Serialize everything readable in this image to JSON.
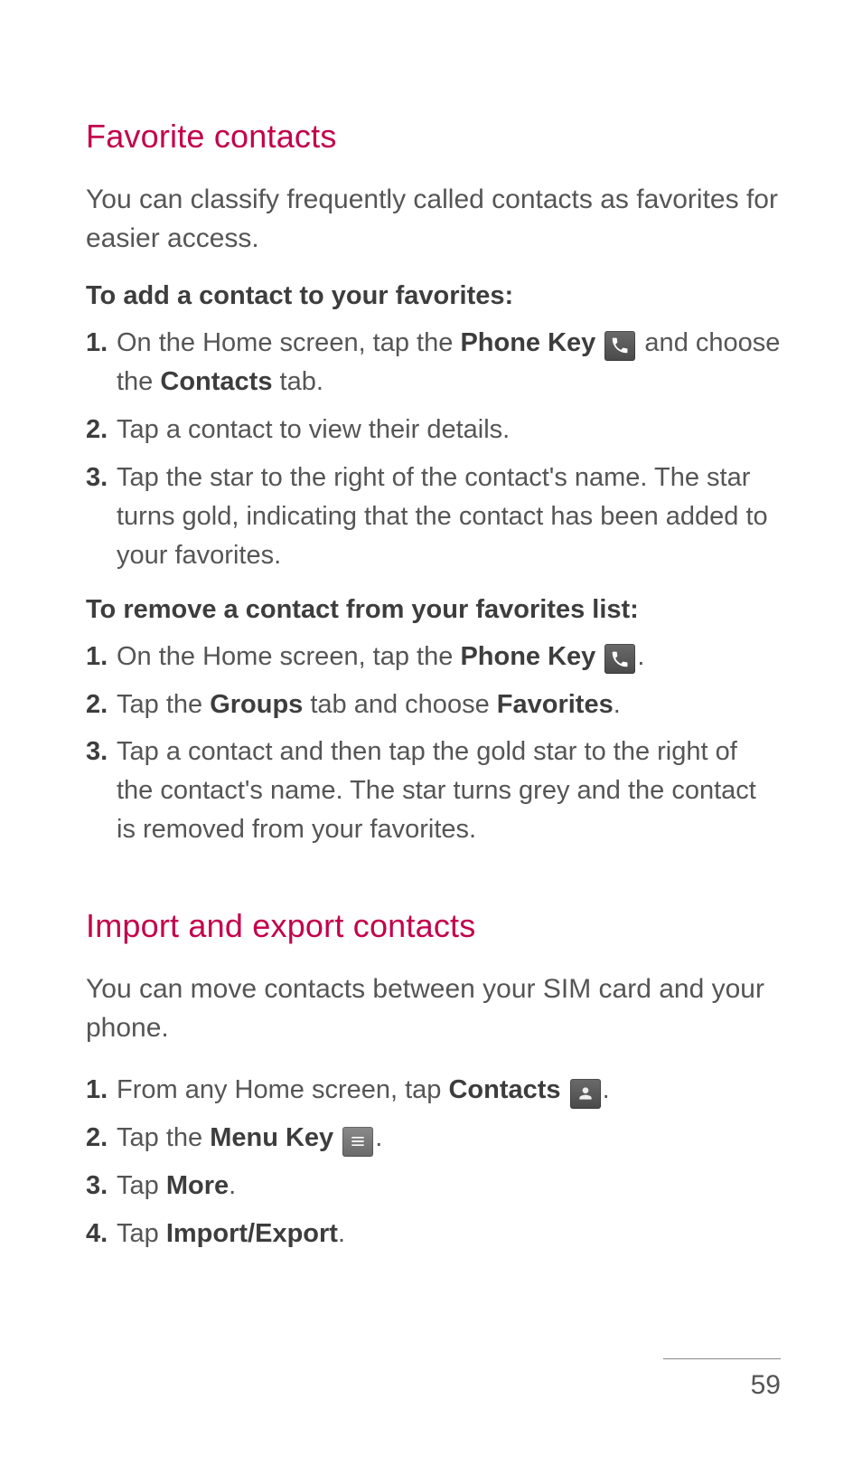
{
  "sections": {
    "fav": {
      "title": "Favorite contacts",
      "intro": "You can classify frequently called contacts as favorites for easier access."
    },
    "imp": {
      "title": "Import and export contacts",
      "intro": "You can move contacts between your SIM card and your phone."
    }
  },
  "subheads": {
    "add": "To add a contact to your favorites:",
    "remove": "To remove a contact from your favorites list:"
  },
  "add": {
    "s1_a": "On the Home screen, tap the ",
    "s1_b": "Phone Key",
    "s1_c": " and choose the ",
    "s1_d": "Contacts",
    "s1_e": " tab.",
    "s2": "Tap a contact to view their details.",
    "s3": "Tap the star to the right of the contact's name. The star turns gold, indicating that the contact has been added to your favorites."
  },
  "remove": {
    "s1_a": "On the Home screen, tap the ",
    "s1_b": "Phone Key",
    "s1_c": ".",
    "s2_a": "Tap the ",
    "s2_b": "Groups",
    "s2_c": " tab and choose ",
    "s2_d": "Favorites",
    "s2_e": ".",
    "s3": "Tap a contact and then tap the gold star to the right of the contact's name. The star turns grey and the contact is removed from your favorites."
  },
  "import": {
    "s1_a": "From any Home screen, tap ",
    "s1_b": "Contacts",
    "s1_c": ".",
    "s2_a": "Tap the ",
    "s2_b": "Menu Key",
    "s2_c": ".",
    "s3_a": "Tap ",
    "s3_b": "More",
    "s3_c": ".",
    "s4_a": "Tap ",
    "s4_b": "Import/Export",
    "s4_c": "."
  },
  "nums": {
    "n1": "1.",
    "n2": "2.",
    "n3": "3.",
    "n4": "4."
  },
  "page_number": "59"
}
